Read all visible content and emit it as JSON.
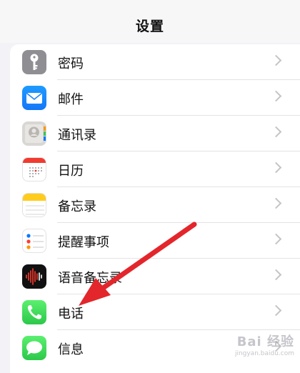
{
  "header": {
    "title": "设置"
  },
  "settings": {
    "items": [
      {
        "label": "密码",
        "icon": "key-icon"
      },
      {
        "label": "邮件",
        "icon": "mail-icon"
      },
      {
        "label": "通讯录",
        "icon": "contacts-icon"
      },
      {
        "label": "日历",
        "icon": "calendar-icon"
      },
      {
        "label": "备忘录",
        "icon": "notes-icon"
      },
      {
        "label": "提醒事项",
        "icon": "reminders-icon"
      },
      {
        "label": "语音备忘录",
        "icon": "voice-memos-icon"
      },
      {
        "label": "电话",
        "icon": "phone-icon"
      },
      {
        "label": "信息",
        "icon": "messages-icon"
      }
    ]
  },
  "annotation": {
    "color": "#e3262b",
    "target": "电话"
  },
  "watermark": {
    "brand": "Bai 经验",
    "url": "jingyan.baidu.com"
  }
}
